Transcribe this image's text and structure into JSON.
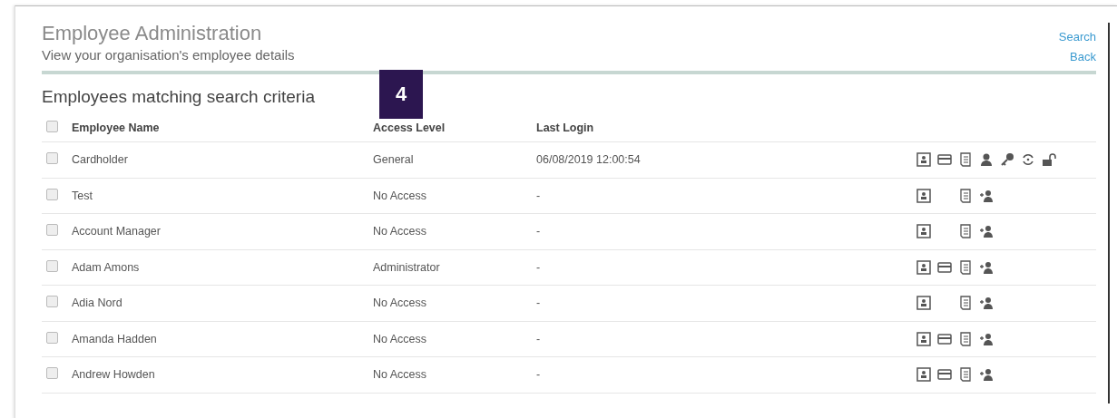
{
  "header": {
    "title": "Employee Administration",
    "subtitle": "View your organisation's employee details"
  },
  "links": [
    "Search",
    "Back"
  ],
  "step_badge": "4",
  "section_title": "Employees matching search criteria",
  "table": {
    "select_all": {
      "checked": false
    },
    "columns": [
      "Employee Name",
      "Access Level",
      "Last Login"
    ],
    "rows": [
      {
        "name": "Cardholder",
        "access_level": "General",
        "last_login": "06/08/2019 12:00:54",
        "checked": false,
        "actions": [
          {
            "kind": "badge"
          },
          {
            "kind": "card"
          },
          {
            "kind": "document"
          },
          {
            "kind": "user"
          },
          {
            "kind": "key"
          },
          {
            "kind": "sync"
          },
          {
            "kind": "unlock"
          }
        ]
      },
      {
        "name": "Test",
        "access_level": "No Access",
        "last_login": "-",
        "checked": false,
        "actions": [
          {
            "kind": "badge"
          },
          {
            "kind": "document"
          },
          {
            "kind": "add-user"
          }
        ]
      },
      {
        "name": "Account Manager",
        "access_level": "No Access",
        "last_login": "-",
        "checked": false,
        "actions": [
          {
            "kind": "badge"
          },
          {
            "kind": "document"
          },
          {
            "kind": "add-user"
          }
        ]
      },
      {
        "name": "Adam Amons",
        "access_level": "Administrator",
        "last_login": "-",
        "checked": false,
        "actions": [
          {
            "kind": "badge"
          },
          {
            "kind": "card"
          },
          {
            "kind": "document"
          },
          {
            "kind": "add-user"
          }
        ]
      },
      {
        "name": "Adia Nord",
        "access_level": "No Access",
        "last_login": "-",
        "checked": false,
        "actions": [
          {
            "kind": "badge"
          },
          {
            "kind": "document"
          },
          {
            "kind": "add-user"
          }
        ]
      },
      {
        "name": "Amanda Hadden",
        "access_level": "No Access",
        "last_login": "-",
        "checked": false,
        "actions": [
          {
            "kind": "badge"
          },
          {
            "kind": "card"
          },
          {
            "kind": "document"
          },
          {
            "kind": "add-user"
          }
        ]
      },
      {
        "name": "Andrew Howden",
        "access_level": "No Access",
        "last_login": "-",
        "checked": false,
        "actions": [
          {
            "kind": "badge"
          },
          {
            "kind": "card"
          },
          {
            "kind": "document"
          },
          {
            "kind": "add-user"
          }
        ]
      }
    ]
  }
}
